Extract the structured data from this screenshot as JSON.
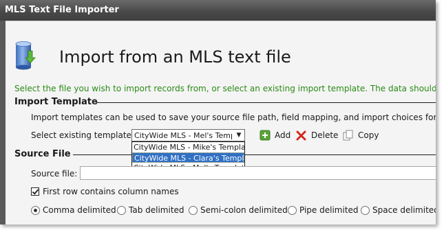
{
  "window": {
    "title": "MLS Text File Importer"
  },
  "header": {
    "title": "Import from an MLS text file"
  },
  "description": "Select the file you wish to import records from, or select an existing import template.  The data should be in",
  "import_template": {
    "section_label": "Import Template",
    "info": "Import templates can be used to save your source file path, field mapping, and import choices for future",
    "select_label": "Select existing template:",
    "selected_value": "CityWide MLS - Mel's Template",
    "options": [
      "CityWide MLS - Mike's Template",
      "CityWide MLS - Clara's Template",
      "CityWide MLS - Mel's Template"
    ],
    "highlighted_index": 1,
    "add_label": "Add",
    "delete_label": "Delete",
    "copy_label": "Copy"
  },
  "source_file": {
    "section_label": "Source File",
    "field_label": "Source file:",
    "value": "",
    "first_row_label": "First row contains column names",
    "first_row_checked": true
  },
  "delimiters": {
    "selected": "Comma delimited",
    "options": [
      "Comma delimited",
      "Tab delimited",
      "Semi-colon delimited",
      "Pipe delimited",
      "Space delimited"
    ]
  },
  "colors": {
    "title_bar": "#4a4a4a",
    "description_text": "#2a8a16",
    "selection": "#3170c4"
  },
  "icons": {
    "header": "database-import-icon",
    "add": "add-icon",
    "delete": "delete-icon",
    "copy": "copy-icon",
    "dropdown": "chevron-down-icon"
  }
}
